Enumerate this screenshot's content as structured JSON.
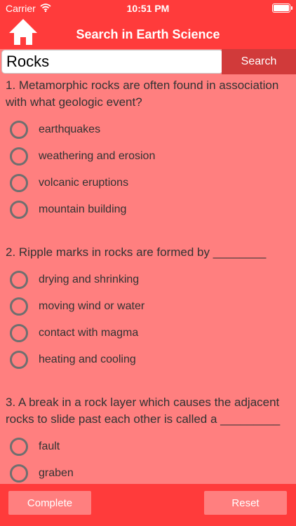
{
  "status_bar": {
    "carrier": "Carrier",
    "time": "10:51 PM",
    "wifi_icon": "wifi-icon",
    "battery_icon": "battery-icon"
  },
  "nav": {
    "title": "Search in Earth Science",
    "home_icon": "home-icon"
  },
  "search": {
    "value": "Rocks",
    "button_label": "Search"
  },
  "questions": [
    {
      "text": "1. Metamorphic rocks are often found in association with what geologic event?",
      "options": [
        "earthquakes",
        "weathering and erosion",
        "volcanic eruptions",
        "mountain building"
      ]
    },
    {
      "text": "2. Ripple marks in rocks are formed by ________",
      "options": [
        "drying and shrinking",
        "moving wind or water",
        "contact with magma",
        "heating and cooling"
      ]
    },
    {
      "text": "3. A break in a rock layer which causes the adjacent rocks to slide past each other is called a _________",
      "options": [
        "fault",
        "graben"
      ]
    }
  ],
  "footer": {
    "complete_label": "Complete",
    "reset_label": "Reset"
  },
  "colors": {
    "header": "#ff3b3b",
    "background": "#ff7f7f",
    "search_button": "#d13a3a"
  }
}
